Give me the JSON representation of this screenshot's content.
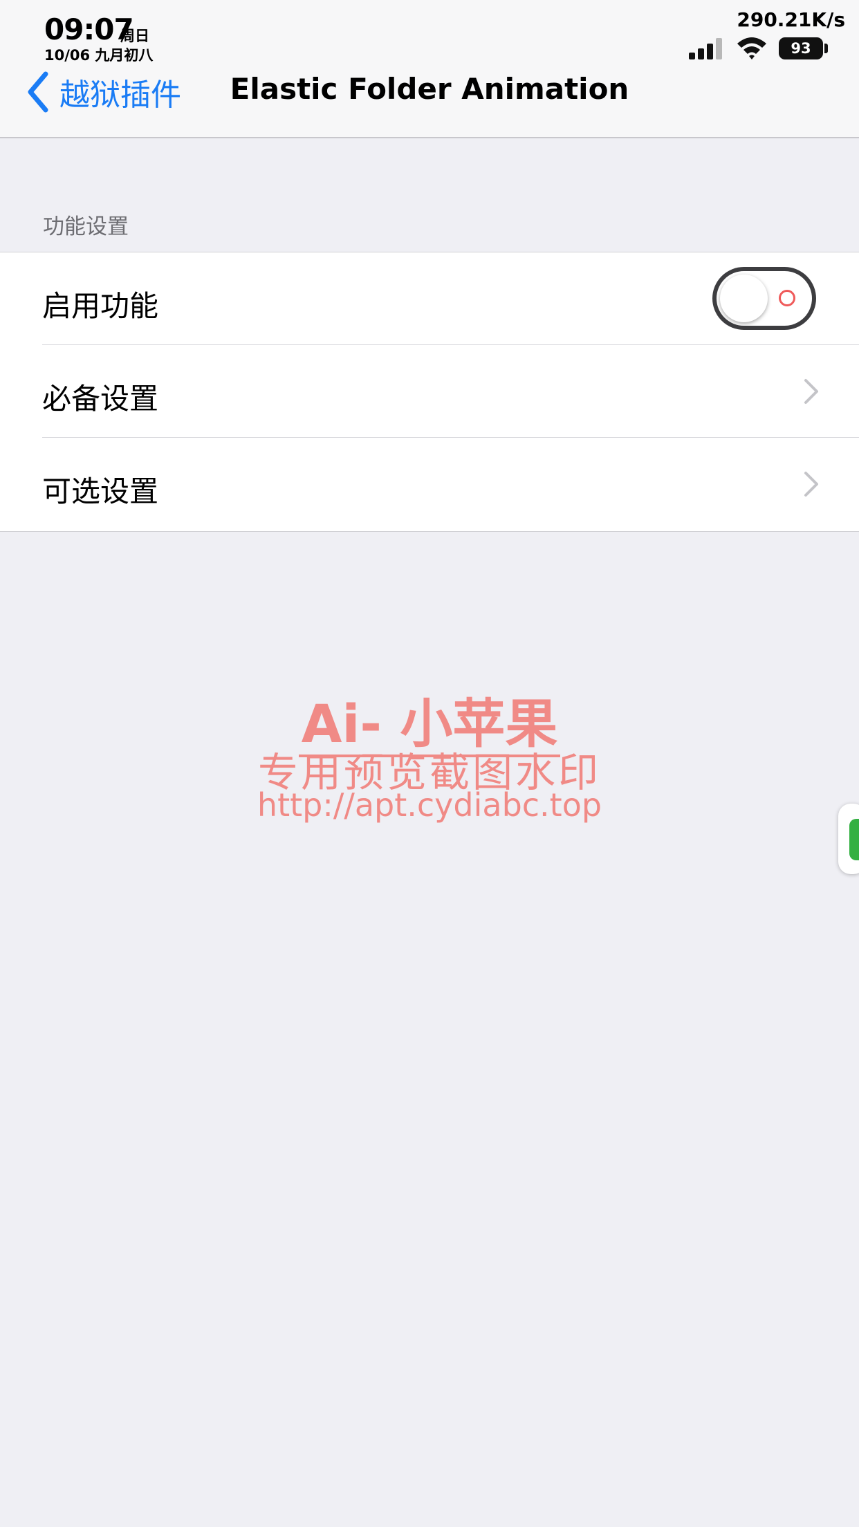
{
  "status_bar": {
    "time": "09:07",
    "weekday": "周日",
    "date": "10/06 九月初八",
    "net_speed": "290.21K/s",
    "battery": "93"
  },
  "nav": {
    "back_label": "越狱插件",
    "title": "Elastic Folder Animation",
    "accent_color": "#1a7cf5"
  },
  "section": {
    "header": "功能设置",
    "rows": [
      {
        "label": "启用功能",
        "type": "toggle",
        "enabled": false
      },
      {
        "label": "必备设置",
        "type": "disclosure"
      },
      {
        "label": "可选设置",
        "type": "disclosure"
      }
    ]
  },
  "watermark": {
    "line1": "Ai- 小苹果",
    "line2": "专用预览截图水印",
    "line3": "http://apt.cydiabc.top",
    "color": "#f08a86"
  }
}
